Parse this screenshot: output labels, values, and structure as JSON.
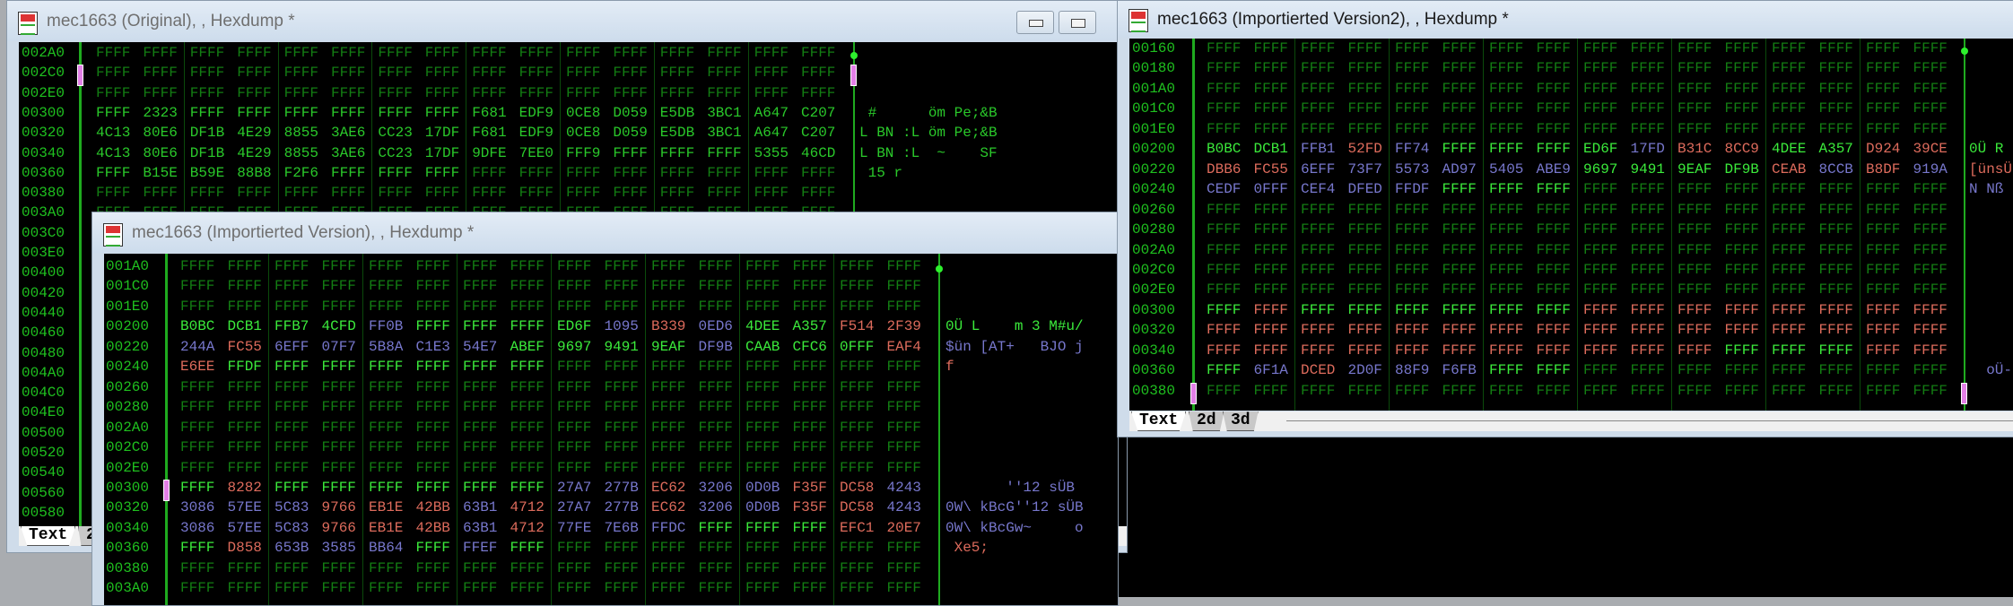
{
  "fill_word": "FFFF",
  "win1": {
    "title": "mec1663 (Original), , Hexdump *",
    "tabs": [
      "Text",
      "2"
    ],
    "rows": [
      {
        "addr": "002A0"
      },
      {
        "addr": "002C0"
      },
      {
        "addr": "002E0"
      },
      {
        "addr": "00300",
        "hex": "FFFF 2323 FFFF FFFF FFFF FFFF FFFF FFFF F681 EDF9 0CE8 D059 E5DB 3BC1 A647 C207",
        "colors": "nnnnnnnnnnnnnnnn",
        "ascii": " #      öm Pe;&B",
        "ascii_color": "n"
      },
      {
        "addr": "00320",
        "hex": "4C13 80E6 DF1B 4E29 8855 3AE6 CC23 17DF F681 EDF9 0CE8 D059 E5DB 3BC1 A647 C207",
        "colors": "nnnnnnnnnnnnnnnn",
        "ascii": "L BN :L öm Pe;&B",
        "ascii_color": "n"
      },
      {
        "addr": "00340",
        "hex": "4C13 80E6 DF1B 4E29 8855 3AE6 CC23 17DF 9DFE 7EE0 FFF9 FFFF FFFF FFFF 5355 46CD",
        "colors": "nnnnnnnnnnnnnnnn",
        "ascii": "L BN :L  ~    SF",
        "ascii_color": "n"
      },
      {
        "addr": "00360",
        "hex": "FFFF B15E B59E 88B8 F2F6 FFFF FFFF FFFF FFFF FFFF FFFF FFFF FFFF FFFF FFFF FFFF",
        "colors": "nnnnnnnndddddddd",
        "ascii": " 15 r",
        "ascii_color": "n"
      },
      {
        "addr": "00380"
      },
      {
        "addr": "003A0"
      },
      {
        "addr": "003C0"
      },
      {
        "addr": "003E0"
      },
      {
        "addr": "00400"
      },
      {
        "addr": "00420"
      },
      {
        "addr": "00440"
      },
      {
        "addr": "00460"
      },
      {
        "addr": "00480"
      },
      {
        "addr": "004A0"
      },
      {
        "addr": "004C0"
      },
      {
        "addr": "004E0"
      },
      {
        "addr": "00500"
      },
      {
        "addr": "00520"
      },
      {
        "addr": "00540"
      },
      {
        "addr": "00560"
      },
      {
        "addr": "00580"
      }
    ]
  },
  "win2": {
    "title": "mec1663 (Importierted Version), , Hexdump *",
    "rows": [
      {
        "addr": "001A0"
      },
      {
        "addr": "001C0"
      },
      {
        "addr": "001E0"
      },
      {
        "addr": "00200",
        "hex": "B0BC DCB1 FFB7 4CFD FF0B FFFF FFFF FFFF ED6F 1095 B339 0ED6 4DEE A357 F514 2F39",
        "colors": "ggggbggggbrbggrr",
        "ascii": "0Ü L    m 3 M#u/",
        "ascii_color": "g"
      },
      {
        "addr": "00220",
        "hex": "244A FC55 6EFF 07F7 5B8A C1E3 54E7 ABEF 9697 9491 9EAF DF9B CAAB CFC6 0FFF EAF4",
        "colors": "brbbbbbggggbgggr",
        "ascii": "$ün [AT+   BJO j",
        "ascii_color": "b"
      },
      {
        "addr": "00240",
        "hex": "E6EE FFDF FFFF FFFF FFFF FFFF FFFF FFFF FFFF FFFF FFFF FFFF FFFF FFFF FFFF FFFF",
        "colors": "rgggggggdddddddd",
        "ascii": "f",
        "ascii_color": "r"
      },
      {
        "addr": "00260"
      },
      {
        "addr": "00280"
      },
      {
        "addr": "002A0"
      },
      {
        "addr": "002C0"
      },
      {
        "addr": "002E0"
      },
      {
        "addr": "00300",
        "hex": "FFFF 8282 FFFF FFFF FFFF FFFF FFFF FFFF 27A7 277B EC62 3206 0D0B F35F DC58 4243",
        "colors": "grggggggbbrbbrrb",
        "ascii": "       ''12 sÜB",
        "ascii_color": "b"
      },
      {
        "addr": "00320",
        "hex": "3086 57EE 5C83 9766 EB1E 42BB 63B1 4712 27A7 277B EC62 3206 0D0B F35F DC58 4243",
        "colors": "bbbrrrbrbbrbbrrb",
        "ascii": "0W\\ kBcG''12 sÜB",
        "ascii_color": "b"
      },
      {
        "addr": "00340",
        "hex": "3086 57EE 5C83 9766 EB1E 42BB 63B1 4712 77FE 7E6B FFDC FFFF FFFF FFFF EFC1 20E7",
        "colors": "bbbrrrbrbbbgggrr",
        "ascii": "0W\\ kBcGw~     o",
        "ascii_color": "b"
      },
      {
        "addr": "00360",
        "hex": "FFFF D858 653B 3585 BB64 FFFF FFEF FFFF FFFF FFFF FFFF FFFF FFFF FFFF FFFF FFFF",
        "colors": "grbbbgbgdddddddd",
        "ascii": " Xe5;",
        "ascii_color": "r"
      },
      {
        "addr": "00380"
      },
      {
        "addr": "003A0"
      }
    ]
  },
  "win3": {
    "title": "mec1663 (Importierted Version2), , Hexdump *",
    "tabs": [
      "Text",
      "2d",
      "3d"
    ],
    "rows": [
      {
        "addr": "00160"
      },
      {
        "addr": "00180"
      },
      {
        "addr": "001A0"
      },
      {
        "addr": "001C0"
      },
      {
        "addr": "001E0"
      },
      {
        "addr": "00200",
        "hex": "B0BC DCB1 FFB1 52FD FF74 FFFF FFFF FFFF ED6F 17FD B31C 8CC9 4DEE A357 D924 39CE",
        "colors": "ggbrbggggbrrggrr",
        "ascii": "0Ü R",
        "ascii_color": "g"
      },
      {
        "addr": "00220",
        "hex": "DBB6 FC55 6EFF 73F7 5573 AD97 5405 ABE9 9697 9491 9EAF DF9B CEAB 8CCB B8DF 919A",
        "colors": "rrbbbbbbggggrbrb",
        "ascii": "[ünsÜ",
        "ascii_color": "r"
      },
      {
        "addr": "00240",
        "hex": "CEDF 0FFF CEF4 DFED FFDF FFFF FFFF FFFF FFFF FFFF FFFF FFFF FFFF FFFF FFFF FFFF",
        "colors": "bbbbbgggdddddddd",
        "ascii": "N Nß",
        "ascii_color": "b"
      },
      {
        "addr": "00260"
      },
      {
        "addr": "00280"
      },
      {
        "addr": "002A0"
      },
      {
        "addr": "002C0"
      },
      {
        "addr": "002E0"
      },
      {
        "addr": "00300",
        "hex": "FFFF FFFF FFFF FFFF FFFF FFFF FFFF FFFF FFFF FFFF FFFF FFFF FFFF FFFF FFFF FFFF",
        "colors": "grggggggrrrrrrrr"
      },
      {
        "addr": "00320",
        "hex": "FFFF FFFF FFFF FFFF FFFF FFFF FFFF FFFF FFFF FFFF FFFF FFFF FFFF FFFF FFFF FFFF",
        "colors": "rrrrrrrrrrrrrrrr"
      },
      {
        "addr": "00340",
        "hex": "FFFF FFFF FFFF FFFF FFFF FFFF FFFF FFFF FFFF FFFF FFFF FFFF FFFF FFFF FFFF FFFF",
        "colors": "rrrrrrrrrrrgggrr"
      },
      {
        "addr": "00360",
        "hex": "FFFF 6F1A DCED 2D0F 88F9 F6FB FFFF FFFF FFFF FFFF FFFF FFFF FFFF FFFF FFFF FFFF",
        "colors": "gbrbbbggdddddddd",
        "ascii": "  oÜ-",
        "ascii_color": "b"
      },
      {
        "addr": "00380"
      }
    ]
  }
}
